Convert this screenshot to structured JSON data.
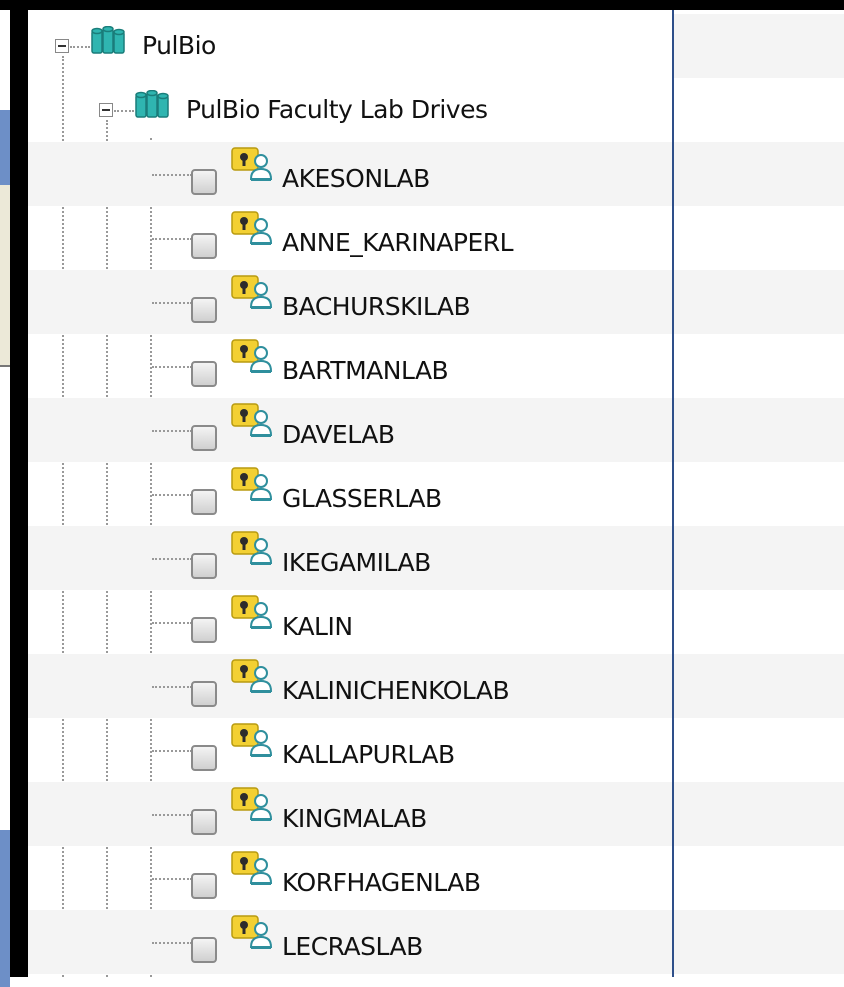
{
  "tree": {
    "root": {
      "label": "PulBio"
    },
    "group": {
      "label": "PulBio Faculty Lab Drives"
    },
    "items": [
      {
        "label": "AKESONLAB"
      },
      {
        "label": "ANNE_KARINAPERL"
      },
      {
        "label": "BACHURSKILAB"
      },
      {
        "label": "BARTMANLAB"
      },
      {
        "label": "DAVELAB"
      },
      {
        "label": "GLASSERLAB"
      },
      {
        "label": "IKEGAMILAB"
      },
      {
        "label": "KALIN"
      },
      {
        "label": "KALINICHENKOLAB"
      },
      {
        "label": "KALLAPURLAB"
      },
      {
        "label": "KINGMALAB"
      },
      {
        "label": "KORFHAGENLAB"
      },
      {
        "label": "LECRASLAB"
      }
    ]
  },
  "icons": {
    "root": "database-icon",
    "group": "database-icon",
    "item": "shared-drive-icon",
    "checkbox": "checkbox-unchecked"
  },
  "colors": {
    "pane_border": "#2e4f8a",
    "alt_row": "#f4f4f4",
    "database_teal": "#2fb5b0",
    "share_yellow": "#f3d033"
  }
}
